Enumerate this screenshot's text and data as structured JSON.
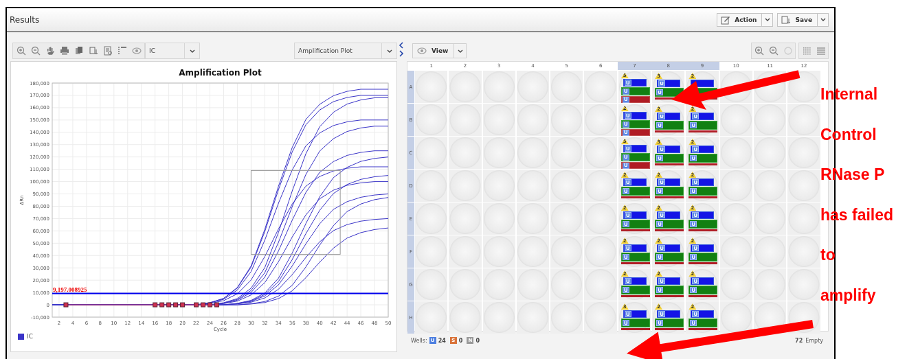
{
  "window": {
    "title": "Results"
  },
  "header_buttons": [
    {
      "label": "Action"
    },
    {
      "label": "Save"
    }
  ],
  "left_toolbar": {
    "target_select": {
      "value": "IC"
    },
    "plot_select": {
      "value": "Amplification Plot"
    }
  },
  "chart": {
    "chart_data": {
      "type": "line",
      "title": "Amplification Plot",
      "xlabel": "Cycle",
      "ylabel": "ΔRn",
      "xlim": [
        1,
        50
      ],
      "ylim": [
        -10000,
        180000
      ],
      "grid": true,
      "xticks": [
        2,
        4,
        6,
        8,
        10,
        12,
        14,
        16,
        18,
        20,
        22,
        24,
        26,
        28,
        30,
        32,
        34,
        36,
        38,
        40,
        42,
        44,
        46,
        48,
        50
      ],
      "yticks": [
        {
          "value": -10000,
          "label": "-10,000"
        },
        {
          "value": 0,
          "label": "0"
        },
        {
          "value": 10000,
          "label": "10,000"
        },
        {
          "value": 20000,
          "label": "20,000"
        },
        {
          "value": 30000,
          "label": "30,000"
        },
        {
          "value": 40000,
          "label": "40,000"
        },
        {
          "value": 50000,
          "label": "50,000"
        },
        {
          "value": 60000,
          "label": "60,000"
        },
        {
          "value": 70000,
          "label": "70,000"
        },
        {
          "value": 80000,
          "label": "80,000"
        },
        {
          "value": 90000,
          "label": "90,000"
        },
        {
          "value": 100000,
          "label": "100,000"
        },
        {
          "value": 110000,
          "label": "110,000"
        },
        {
          "value": 120000,
          "label": "120,000"
        },
        {
          "value": 130000,
          "label": "130,000"
        },
        {
          "value": 140000,
          "label": "140,000"
        },
        {
          "value": 150000,
          "label": "150,000"
        },
        {
          "value": 160000,
          "label": "160,000"
        },
        {
          "value": 170000,
          "label": "170,000"
        },
        {
          "value": 180000,
          "label": "180,000"
        }
      ],
      "x": [
        1,
        3,
        16,
        17,
        18,
        19,
        20,
        22,
        23,
        24,
        25,
        26,
        28,
        30,
        32,
        34,
        36,
        38,
        40,
        42,
        44,
        46,
        48,
        50
      ],
      "series": [
        {
          "name": "IC",
          "color": "#3a34c8",
          "values": [
            0,
            0,
            0,
            0,
            0,
            0,
            0,
            0,
            875,
            1750,
            3500,
            5250,
            14000,
            31500,
            61250,
            96250,
            127750,
            150500,
            162750,
            169750,
            173250,
            175000,
            175000,
            175000
          ]
        },
        {
          "color": "#3a34c8",
          "values": [
            0,
            0,
            0,
            0,
            0,
            0,
            0,
            0,
            850,
            1700,
            3400,
            5100,
            13600,
            30600,
            59500,
            93500,
            124100,
            146200,
            158100,
            164900,
            168300,
            170000,
            170000,
            170000
          ]
        },
        {
          "color": "#3a34c8",
          "values": [
            0,
            0,
            0,
            0,
            0,
            0,
            0,
            0,
            0,
            0,
            840,
            1680,
            5040,
            13440,
            30240,
            58800,
            92400,
            122640,
            144480,
            156240,
            162960,
            166320,
            168000,
            168000
          ]
        },
        {
          "color": "#3a34c8",
          "values": [
            0,
            0,
            0,
            0,
            0,
            0,
            0,
            0,
            750,
            1500,
            3000,
            4500,
            12000,
            27000,
            52500,
            82500,
            109500,
            129000,
            139500,
            145500,
            148500,
            150000,
            150000,
            150000
          ]
        },
        {
          "color": "#3a34c8",
          "values": [
            0,
            0,
            0,
            0,
            0,
            0,
            0,
            0,
            0,
            0,
            725,
            1450,
            4350,
            11600,
            26100,
            50750,
            79750,
            105850,
            124700,
            134850,
            140650,
            143550,
            145000,
            145000
          ]
        },
        {
          "color": "#3a34c8",
          "values": [
            0,
            0,
            0,
            0,
            0,
            0,
            0,
            0,
            0,
            0,
            625,
            1250,
            3750,
            10000,
            22500,
            43750,
            68750,
            91250,
            107500,
            116250,
            121250,
            123750,
            125000,
            125000
          ]
        },
        {
          "color": "#3a34c8",
          "values": [
            0,
            0,
            0,
            0,
            0,
            0,
            0,
            0,
            0,
            0,
            0,
            0,
            1200,
            3600,
            9600,
            21600,
            42000,
            66000,
            87600,
            103200,
            111600,
            116400,
            118800,
            120000
          ]
        },
        {
          "color": "#3a34c8",
          "values": [
            0,
            0,
            0,
            0,
            0,
            0,
            0,
            0,
            560,
            1120,
            2240,
            3360,
            8960,
            20160,
            39200,
            61600,
            81760,
            96320,
            104160,
            108640,
            110880,
            112000,
            112000,
            112000
          ]
        },
        {
          "color": "#3a34c8",
          "values": [
            0,
            0,
            0,
            0,
            0,
            0,
            0,
            0,
            0,
            0,
            0,
            0,
            1050,
            3150,
            8400,
            18900,
            36750,
            57750,
            76650,
            90300,
            97650,
            101850,
            103950,
            105000
          ]
        },
        {
          "color": "#3a34c8",
          "values": [
            0,
            0,
            0,
            0,
            0,
            0,
            0,
            0,
            0,
            0,
            500,
            1000,
            3000,
            8000,
            18000,
            35000,
            55000,
            73000,
            86000,
            93000,
            97000,
            99000,
            100000,
            100000
          ]
        },
        {
          "color": "#3a34c8",
          "values": [
            0,
            0,
            0,
            0,
            0,
            0,
            0,
            0,
            0,
            0,
            0,
            0,
            900,
            2700,
            7200,
            16200,
            31500,
            49500,
            65700,
            77400,
            83700,
            87300,
            89100,
            90000
          ]
        },
        {
          "color": "#3a34c8",
          "values": [
            0,
            0,
            0,
            0,
            0,
            0,
            0,
            0,
            0,
            0,
            0,
            0,
            0,
            880,
            2640,
            7040,
            15840,
            30800,
            48400,
            64240,
            75680,
            81840,
            85360,
            87120
          ]
        },
        {
          "color": "#3a34c8",
          "values": [
            0,
            0,
            0,
            0,
            0,
            0,
            0,
            0,
            0,
            0,
            0,
            0,
            700,
            2100,
            5600,
            12600,
            24500,
            38500,
            51100,
            60200,
            65100,
            67900,
            69300,
            70000
          ]
        },
        {
          "color": "#3a34c8",
          "values": [
            0,
            0,
            0,
            0,
            0,
            0,
            0,
            0,
            0,
            0,
            0,
            0,
            0,
            630,
            1890,
            5040,
            11340,
            22050,
            34650,
            45990,
            54180,
            58590,
            61110,
            62370
          ]
        },
        {
          "color": "#d03050",
          "marker": "square",
          "values": [
            null,
            0,
            0,
            0,
            0,
            0,
            0,
            0,
            0,
            0,
            0,
            null,
            null,
            null,
            null,
            null,
            null,
            null,
            null,
            null,
            null,
            null,
            null,
            null
          ]
        }
      ],
      "ref_lines": [
        {
          "axis": "y",
          "value": 9197.008925,
          "label": "9,197.008925",
          "color": "#0000ee"
        }
      ]
    }
  },
  "right_toolbar": {
    "view_button": {
      "label": "View"
    }
  },
  "plate": {
    "columns": [
      {
        "label": "1",
        "selected": false
      },
      {
        "label": "2",
        "selected": false
      },
      {
        "label": "3",
        "selected": false
      },
      {
        "label": "4",
        "selected": false
      },
      {
        "label": "5",
        "selected": false
      },
      {
        "label": "6",
        "selected": false
      },
      {
        "label": "7",
        "selected": true
      },
      {
        "label": "8",
        "selected": true
      },
      {
        "label": "9",
        "selected": true
      },
      {
        "label": "10",
        "selected": false
      },
      {
        "label": "11",
        "selected": false
      },
      {
        "label": "12",
        "selected": false
      }
    ],
    "rows": [
      {
        "label": "A",
        "selected": true,
        "wells": [
          {
            "kind": "empty"
          },
          {
            "kind": "empty"
          },
          {
            "kind": "empty"
          },
          {
            "kind": "empty"
          },
          {
            "kind": "empty"
          },
          {
            "kind": "empty"
          },
          {
            "kind": "sample",
            "badge": "5",
            "targets": [
              {
                "label": "U",
                "color": "#1414e6"
              },
              {
                "label": "U",
                "color": "#128012"
              },
              {
                "label": "U",
                "color": "#b01c24"
              }
            ]
          },
          {
            "kind": "sample",
            "badge": "3",
            "targets": [
              {
                "label": "U",
                "color": "#1414e6"
              },
              {
                "label": "U",
                "color": "#128012"
              },
              {
                "color": "#b01c24"
              }
            ]
          },
          {
            "kind": "sample",
            "badge": "2",
            "targets": [
              {
                "color": "#1414e6"
              },
              {
                "color": "#128012"
              },
              {
                "color": "#b01c24"
              }
            ]
          },
          {
            "kind": "empty"
          },
          {
            "kind": "empty"
          },
          {
            "kind": "empty"
          }
        ]
      },
      {
        "label": "B",
        "selected": true,
        "wells": [
          {
            "kind": "empty"
          },
          {
            "kind": "empty"
          },
          {
            "kind": "empty"
          },
          {
            "kind": "empty"
          },
          {
            "kind": "empty"
          },
          {
            "kind": "empty"
          },
          {
            "kind": "sample",
            "badge": "2",
            "targets": [
              {
                "label": "U",
                "color": "#1414e6"
              },
              {
                "label": "U",
                "color": "#128012"
              },
              {
                "label": "U",
                "color": "#b01c24"
              }
            ]
          },
          {
            "kind": "sample",
            "badge": "2",
            "targets": [
              {
                "label": "U",
                "color": "#1414e6"
              },
              {
                "label": "U",
                "color": "#128012"
              },
              {
                "color": "#b01c24"
              }
            ]
          },
          {
            "kind": "sample",
            "badge": "2",
            "targets": [
              {
                "label": "U",
                "color": "#1414e6"
              },
              {
                "label": "U",
                "color": "#128012"
              },
              {
                "color": "#b01c24"
              }
            ]
          },
          {
            "kind": "empty"
          },
          {
            "kind": "empty"
          },
          {
            "kind": "empty"
          }
        ]
      },
      {
        "label": "C",
        "selected": true,
        "wells": [
          {
            "kind": "empty"
          },
          {
            "kind": "empty"
          },
          {
            "kind": "empty"
          },
          {
            "kind": "empty"
          },
          {
            "kind": "empty"
          },
          {
            "kind": "empty"
          },
          {
            "kind": "sample",
            "badge": "5",
            "targets": [
              {
                "label": "U",
                "color": "#1414e6"
              },
              {
                "label": "U",
                "color": "#128012"
              },
              {
                "label": "U",
                "color": "#b01c24"
              }
            ]
          },
          {
            "kind": "sample",
            "badge": "3",
            "targets": [
              {
                "label": "U",
                "color": "#1414e6"
              },
              {
                "label": "U",
                "color": "#128012"
              },
              {
                "color": "#b01c24"
              }
            ]
          },
          {
            "kind": "sample",
            "badge": "2",
            "targets": [
              {
                "label": "U",
                "color": "#1414e6"
              },
              {
                "label": "U",
                "color": "#128012"
              },
              {
                "color": "#b01c24"
              }
            ]
          },
          {
            "kind": "empty"
          },
          {
            "kind": "empty"
          },
          {
            "kind": "empty"
          }
        ]
      },
      {
        "label": "D",
        "selected": true,
        "wells": [
          {
            "kind": "empty"
          },
          {
            "kind": "empty"
          },
          {
            "kind": "empty"
          },
          {
            "kind": "empty"
          },
          {
            "kind": "empty"
          },
          {
            "kind": "empty"
          },
          {
            "kind": "sample",
            "badge": "2",
            "targets": [
              {
                "label": "U",
                "color": "#1414e6"
              },
              {
                "label": "U",
                "color": "#128012"
              },
              {
                "color": "#b01c24"
              }
            ]
          },
          {
            "kind": "sample",
            "badge": "2",
            "targets": [
              {
                "label": "U",
                "color": "#1414e6"
              },
              {
                "label": "U",
                "color": "#128012"
              },
              {
                "color": "#b01c24"
              }
            ]
          },
          {
            "kind": "sample",
            "badge": "2",
            "targets": [
              {
                "label": "U",
                "color": "#1414e6"
              },
              {
                "label": "U",
                "color": "#128012"
              },
              {
                "color": "#b01c24"
              }
            ]
          },
          {
            "kind": "empty"
          },
          {
            "kind": "empty"
          },
          {
            "kind": "empty"
          }
        ]
      },
      {
        "label": "E",
        "selected": true,
        "wells": [
          {
            "kind": "empty"
          },
          {
            "kind": "empty"
          },
          {
            "kind": "empty"
          },
          {
            "kind": "empty"
          },
          {
            "kind": "empty"
          },
          {
            "kind": "empty"
          },
          {
            "kind": "sample",
            "badge": "2",
            "targets": [
              {
                "label": "U",
                "color": "#1414e6"
              },
              {
                "label": "U",
                "color": "#128012"
              },
              {
                "color": "#b01c24"
              }
            ]
          },
          {
            "kind": "sample",
            "badge": "2",
            "targets": [
              {
                "label": "U",
                "color": "#1414e6"
              },
              {
                "label": "U",
                "color": "#128012"
              },
              {
                "color": "#b01c24"
              }
            ]
          },
          {
            "kind": "sample",
            "badge": "2",
            "targets": [
              {
                "label": "U",
                "color": "#1414e6"
              },
              {
                "label": "U",
                "color": "#128012"
              },
              {
                "color": "#b01c24"
              }
            ]
          },
          {
            "kind": "empty"
          },
          {
            "kind": "empty"
          },
          {
            "kind": "empty"
          }
        ]
      },
      {
        "label": "F",
        "selected": true,
        "wells": [
          {
            "kind": "empty"
          },
          {
            "kind": "empty"
          },
          {
            "kind": "empty"
          },
          {
            "kind": "empty"
          },
          {
            "kind": "empty"
          },
          {
            "kind": "empty"
          },
          {
            "kind": "sample",
            "badge": "2",
            "targets": [
              {
                "label": "U",
                "color": "#1414e6"
              },
              {
                "label": "U",
                "color": "#128012"
              },
              {
                "color": "#b01c24"
              }
            ]
          },
          {
            "kind": "sample",
            "badge": "2",
            "targets": [
              {
                "label": "U",
                "color": "#1414e6"
              },
              {
                "label": "U",
                "color": "#128012"
              },
              {
                "color": "#b01c24"
              }
            ]
          },
          {
            "kind": "sample",
            "badge": "2",
            "targets": [
              {
                "label": "U",
                "color": "#1414e6"
              },
              {
                "label": "U",
                "color": "#128012"
              },
              {
                "color": "#b01c24"
              }
            ]
          },
          {
            "kind": "empty"
          },
          {
            "kind": "empty"
          },
          {
            "kind": "empty"
          }
        ]
      },
      {
        "label": "G",
        "selected": true,
        "wells": [
          {
            "kind": "empty"
          },
          {
            "kind": "empty"
          },
          {
            "kind": "empty"
          },
          {
            "kind": "empty"
          },
          {
            "kind": "empty"
          },
          {
            "kind": "empty"
          },
          {
            "kind": "sample",
            "badge": "2",
            "targets": [
              {
                "label": "U",
                "color": "#1414e6"
              },
              {
                "label": "U",
                "color": "#128012"
              },
              {
                "color": "#b01c24"
              }
            ]
          },
          {
            "kind": "sample",
            "badge": "2",
            "targets": [
              {
                "label": "U",
                "color": "#1414e6"
              },
              {
                "label": "U",
                "color": "#128012"
              },
              {
                "color": "#b01c24"
              }
            ]
          },
          {
            "kind": "sample",
            "badge": "2",
            "targets": [
              {
                "label": "U",
                "color": "#1414e6"
              },
              {
                "label": "U",
                "color": "#128012"
              },
              {
                "color": "#b01c24"
              }
            ]
          },
          {
            "kind": "empty"
          },
          {
            "kind": "empty"
          },
          {
            "kind": "empty"
          }
        ]
      },
      {
        "label": "H",
        "selected": true,
        "wells": [
          {
            "kind": "empty"
          },
          {
            "kind": "empty"
          },
          {
            "kind": "empty"
          },
          {
            "kind": "empty"
          },
          {
            "kind": "empty"
          },
          {
            "kind": "empty"
          },
          {
            "kind": "sample",
            "badge": "3",
            "targets": [
              {
                "label": "U",
                "color": "#1414e6"
              },
              {
                "label": "U",
                "color": "#128012"
              },
              {
                "color": "#b01c24"
              }
            ]
          },
          {
            "kind": "sample",
            "badge": "2",
            "targets": [
              {
                "label": "U",
                "color": "#1414e6"
              },
              {
                "label": "U",
                "color": "#128012"
              },
              {
                "color": "#b01c24"
              }
            ]
          },
          {
            "kind": "sample",
            "badge": "2",
            "targets": [
              {
                "label": "U",
                "color": "#1414e6"
              },
              {
                "label": "U",
                "color": "#128012"
              },
              {
                "color": "#b01c24"
              }
            ]
          },
          {
            "kind": "empty"
          },
          {
            "kind": "empty"
          },
          {
            "kind": "empty"
          }
        ]
      }
    ]
  },
  "footer": {
    "label": "Wells:",
    "counts": [
      {
        "letter": "U",
        "count": "24",
        "color": "#4d7fe0"
      },
      {
        "letter": "S",
        "count": "0",
        "color": "#d9733a"
      },
      {
        "letter": "N",
        "count": "0",
        "color": "#9a9a9a"
      }
    ],
    "empty_count": "72",
    "empty_label": "Empty"
  },
  "annotation": {
    "lines": [
      "Internal",
      "Control",
      "RNase P",
      "has failed",
      "to",
      "amplify"
    ]
  }
}
